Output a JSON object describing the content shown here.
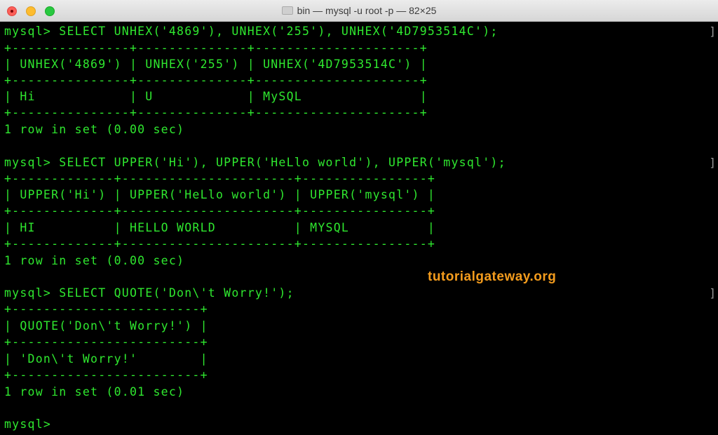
{
  "window": {
    "title": "bin — mysql -u root -p — 82×25"
  },
  "terminal": {
    "lines": [
      "mysql> SELECT UNHEX('4869'), UNHEX('255'), UNHEX('4D7953514C');",
      "+---------------+--------------+---------------------+",
      "| UNHEX('4869') | UNHEX('255') | UNHEX('4D7953514C') |",
      "+---------------+--------------+---------------------+",
      "| Hi            | U            | MySQL               |",
      "+---------------+--------------+---------------------+",
      "1 row in set (0.00 sec)",
      "",
      "mysql> SELECT UPPER('Hi'), UPPER('HeLlo world'), UPPER('mysql');",
      "+-------------+----------------------+----------------+",
      "| UPPER('Hi') | UPPER('HeLlo world') | UPPER('mysql') |",
      "+-------------+----------------------+----------------+",
      "| HI          | HELLO WORLD          | MYSQL          |",
      "+-------------+----------------------+----------------+",
      "1 row in set (0.00 sec)",
      "",
      "mysql> SELECT QUOTE('Don\\'t Worry!');",
      "+------------------------+",
      "| QUOTE('Don\\'t Worry!') |",
      "+------------------------+",
      "| 'Don\\'t Worry!'        |",
      "+------------------------+",
      "1 row in set (0.01 sec)",
      "",
      "mysql>"
    ]
  },
  "watermark": "tutorialgateway.org",
  "colors": {
    "terminal_text": "#2fe82f",
    "terminal_bg": "#000000",
    "watermark": "#f49c1d"
  }
}
